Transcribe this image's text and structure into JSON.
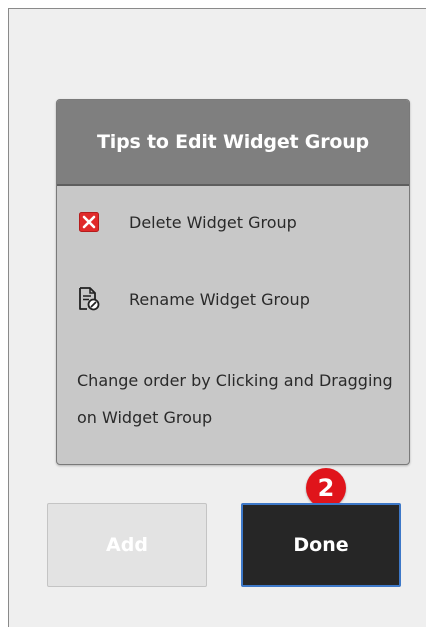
{
  "tips_panel": {
    "title": "Tips to Edit Widget Group",
    "items": [
      {
        "icon": "delete-x-icon",
        "label": "Delete Widget Group"
      },
      {
        "icon": "rename-document-icon",
        "label": "Rename Widget Group"
      }
    ],
    "reorder_tip": "Change order by Clicking and Dragging on Widget Group"
  },
  "buttons": {
    "add_label": "Add",
    "done_label": "Done"
  },
  "step_badge": "2",
  "colors": {
    "header": "#7f7f7f",
    "panel": "#c8c8c8",
    "done_button": "#262626",
    "done_border": "#3d78c8",
    "badge": "#e0141b",
    "delete_icon": "#e02a2a"
  }
}
